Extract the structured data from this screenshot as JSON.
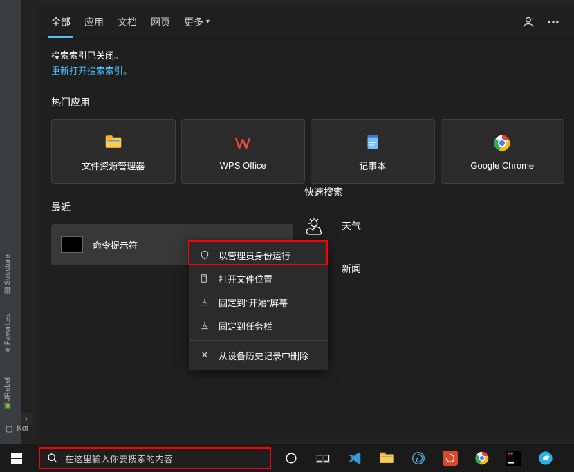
{
  "tabs": {
    "all": "全部",
    "apps": "应用",
    "docs": "文档",
    "web": "网页",
    "more": "更多"
  },
  "indexMsg": {
    "line1": "搜索索引已关闭。",
    "reopen": "重新打开搜索索引。"
  },
  "sections": {
    "hotApps": "热门应用",
    "recent": "最近",
    "quickSearch": "快速搜索"
  },
  "apps": {
    "explorer": "文件资源管理器",
    "wps": "WPS Office",
    "notepad": "记事本",
    "chrome": "Google Chrome"
  },
  "recent": {
    "cmd": "命令提示符"
  },
  "ctx": {
    "runAdmin": "以管理员身份运行",
    "openLoc": "打开文件位置",
    "pinStart": "固定到\"开始\"屏幕",
    "pinTaskbar": "固定到任务栏",
    "removeHistory": "从设备历史记录中删除"
  },
  "quick": {
    "weather": "天气",
    "news": "新闻"
  },
  "taskbar": {
    "searchPlaceholder": "在这里输入你要搜索的内容"
  },
  "ide": {
    "structure": "Structure",
    "favorites": "Favorites",
    "jrebel": "JRebel",
    "kot": "Kot"
  }
}
